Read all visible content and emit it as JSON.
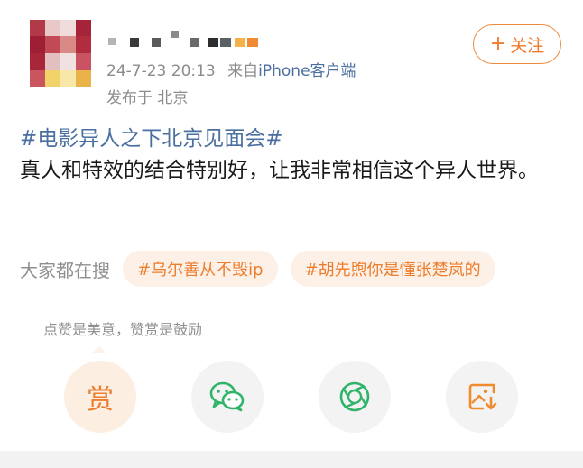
{
  "post": {
    "meta": {
      "date": "24-7-23 20:13",
      "source_prefix": "来自",
      "source": "iPhone客户端",
      "location": "发布于 北京"
    },
    "follow_label": "关注",
    "hashtag": "#电影异人之下北京见面会#",
    "body": "真人和特效的结合特别好，让我非常相信这个异人世界。"
  },
  "search": {
    "label": "大家都在搜",
    "chips": [
      "#乌尔善从不毁ip",
      "#胡先煦你是懂张楚岚的"
    ]
  },
  "reward": {
    "tip": "点赞是美意，赞赏是鼓励",
    "button_label": "赏"
  },
  "icons": {
    "follow": "plus-icon",
    "wechat": "wechat-icon",
    "moments": "moments-icon",
    "save": "save-image-icon"
  },
  "colors": {
    "accent": "#ec7d2d",
    "link": "#4a6fa0",
    "chip_bg": "#fdf0e6",
    "muted": "#8c8c8c"
  }
}
